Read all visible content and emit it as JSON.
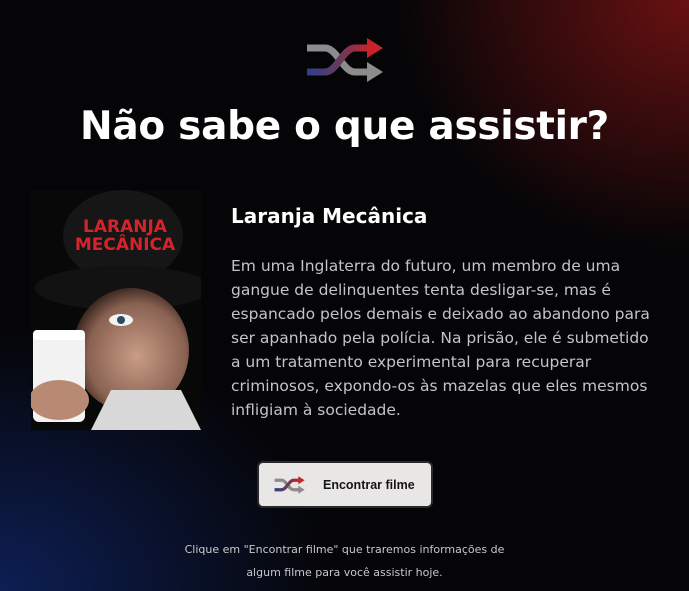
{
  "header": {
    "logo_icon": "shuffle-icon",
    "title": "Não sabe o que assistir?"
  },
  "movie": {
    "poster_title_line1": "LARANJA",
    "poster_title_line2": "MECÂNICA",
    "title": "Laranja Mecânica",
    "description": "Em uma Inglaterra do futuro, um membro de uma gangue de delinquentes tenta desligar-se, mas é espancado pelos demais e deixado ao abandono para ser apanhado pela polícia. Na prisão, ele é submetido a um tratamento experimental para recuperar criminosos, expondo-os às mazelas que eles mesmos infligiam à sociedade."
  },
  "action": {
    "button_icon": "shuffle-icon",
    "button_label": "Encontrar filme"
  },
  "hint": {
    "line1": "Clique em \"Encontrar filme\" que traremos informações de",
    "line2": "algum filme para você assistir hoje."
  },
  "colors": {
    "background": "#050507",
    "accent_red": "#c8222a",
    "accent_blue": "#2a3f8f",
    "button_bg": "#e9e6e6"
  }
}
